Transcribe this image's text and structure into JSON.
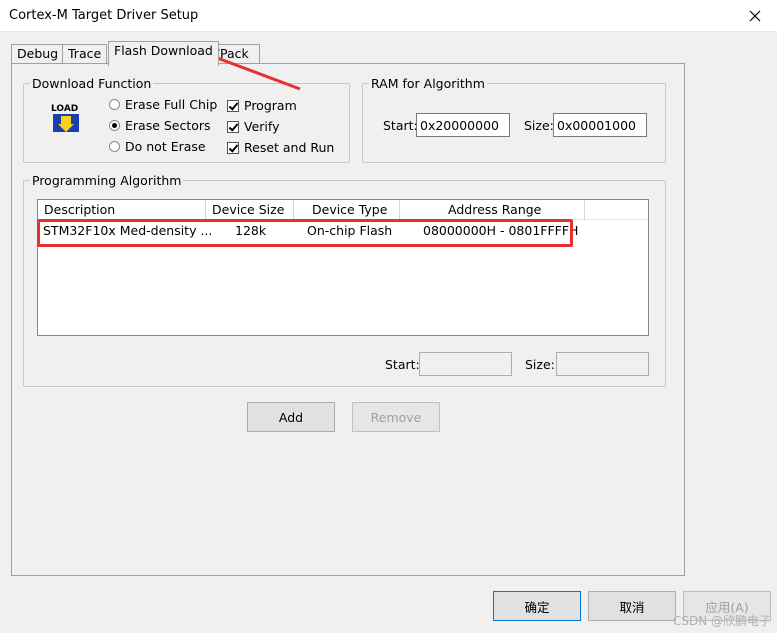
{
  "window": {
    "title": "Cortex-M Target Driver Setup"
  },
  "tabs": [
    {
      "label": "Debug"
    },
    {
      "label": "Trace"
    },
    {
      "label": "Flash Download"
    },
    {
      "label": "Pack"
    }
  ],
  "download_function": {
    "legend": "Download Function",
    "icon_text": "LOAD",
    "radios": [
      {
        "label": "Erase Full Chip",
        "checked": false
      },
      {
        "label": "Erase Sectors",
        "checked": true
      },
      {
        "label": "Do not Erase",
        "checked": false
      }
    ],
    "checks": [
      {
        "label": "Program",
        "checked": true
      },
      {
        "label": "Verify",
        "checked": true
      },
      {
        "label": "Reset and Run",
        "checked": true
      }
    ]
  },
  "ram": {
    "legend": "RAM for Algorithm",
    "start_label": "Start:",
    "start_value": "0x20000000",
    "size_label": "Size:",
    "size_value": "0x00001000"
  },
  "programming_algorithm": {
    "legend": "Programming Algorithm",
    "columns": [
      "Description",
      "Device Size",
      "Device Type",
      "Address Range"
    ],
    "rows": [
      {
        "description": "STM32F10x Med-density ...",
        "size": "128k",
        "type": "On-chip Flash",
        "range": "08000000H - 0801FFFFH"
      }
    ],
    "start_label": "Start:",
    "start_value": "",
    "size_label": "Size:",
    "size_value": ""
  },
  "buttons": {
    "add": "Add",
    "remove": "Remove",
    "ok": "确定",
    "cancel": "取消",
    "apply": "应用(A)"
  },
  "watermark": "CSDN @欣鹏电子",
  "colors": {
    "annotation_red": "#e8302f",
    "focus_blue": "#0078d7"
  }
}
